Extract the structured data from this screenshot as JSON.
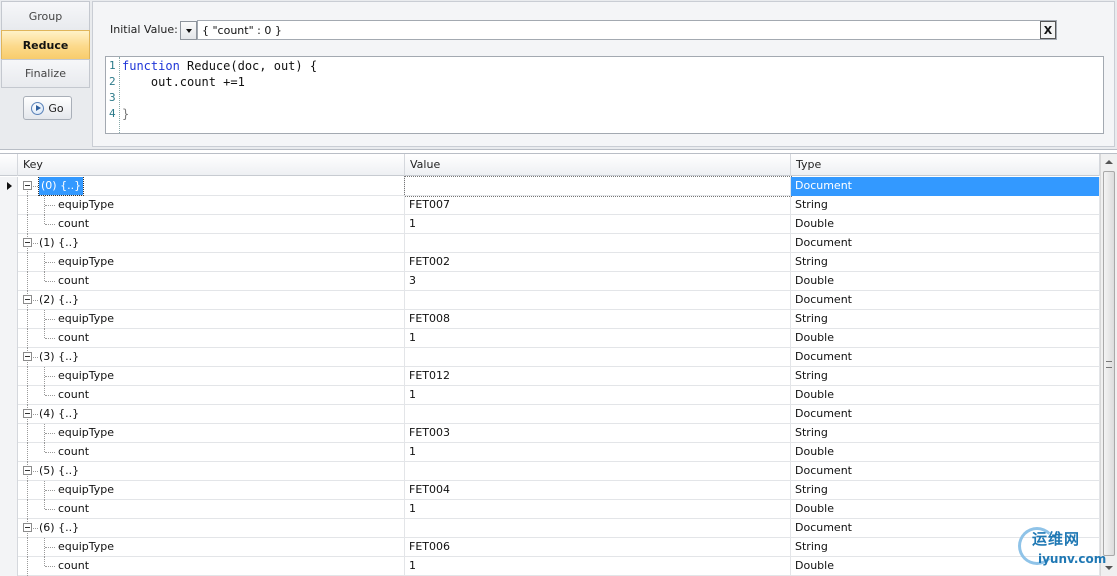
{
  "modes": {
    "tabs": [
      "Group",
      "Reduce",
      "Finalize"
    ],
    "active": "Reduce",
    "go_label": "Go"
  },
  "reduce": {
    "initial_value_label": "Initial Value:",
    "initial_value": "{ \"count\" : 0 }",
    "clear_label": "X",
    "code_lines": [
      {
        "n": "1",
        "kw": "function",
        "text": " Reduce(doc, out) {"
      },
      {
        "n": "2",
        "kw": "",
        "text": "    out.count +=1"
      },
      {
        "n": "3",
        "kw": "",
        "text": ""
      },
      {
        "n": "4",
        "kw": "",
        "text": "}"
      }
    ]
  },
  "grid": {
    "columns": [
      "Key",
      "Value",
      "Type"
    ],
    "rows": [
      {
        "key": "(0) {..}",
        "value": "",
        "type": "Document",
        "level": 0
      },
      {
        "key": "equipType",
        "value": "FET007",
        "type": "String",
        "level": 1
      },
      {
        "key": "count",
        "value": "1",
        "type": "Double",
        "level": 1,
        "last": true
      },
      {
        "key": "(1) {..}",
        "value": "",
        "type": "Document",
        "level": 0
      },
      {
        "key": "equipType",
        "value": "FET002",
        "type": "String",
        "level": 1
      },
      {
        "key": "count",
        "value": "3",
        "type": "Double",
        "level": 1,
        "last": true
      },
      {
        "key": "(2) {..}",
        "value": "",
        "type": "Document",
        "level": 0
      },
      {
        "key": "equipType",
        "value": "FET008",
        "type": "String",
        "level": 1
      },
      {
        "key": "count",
        "value": "1",
        "type": "Double",
        "level": 1,
        "last": true
      },
      {
        "key": "(3) {..}",
        "value": "",
        "type": "Document",
        "level": 0
      },
      {
        "key": "equipType",
        "value": "FET012",
        "type": "String",
        "level": 1
      },
      {
        "key": "count",
        "value": "1",
        "type": "Double",
        "level": 1,
        "last": true
      },
      {
        "key": "(4) {..}",
        "value": "",
        "type": "Document",
        "level": 0
      },
      {
        "key": "equipType",
        "value": "FET003",
        "type": "String",
        "level": 1
      },
      {
        "key": "count",
        "value": "1",
        "type": "Double",
        "level": 1,
        "last": true
      },
      {
        "key": "(5) {..}",
        "value": "",
        "type": "Document",
        "level": 0
      },
      {
        "key": "equipType",
        "value": "FET004",
        "type": "String",
        "level": 1
      },
      {
        "key": "count",
        "value": "1",
        "type": "Double",
        "level": 1,
        "last": true
      },
      {
        "key": "(6) {..}",
        "value": "",
        "type": "Document",
        "level": 0
      },
      {
        "key": "equipType",
        "value": "FET006",
        "type": "String",
        "level": 1
      },
      {
        "key": "count",
        "value": "1",
        "type": "Double",
        "level": 1,
        "last": true
      }
    ],
    "selected_row": 0
  },
  "watermark": {
    "top_text": "运维网",
    "bottom_text": "iyunv.com"
  },
  "colors": {
    "selection": "#3399ff",
    "active_tab": "#fcd98a",
    "keyword": "#1f36d8"
  }
}
